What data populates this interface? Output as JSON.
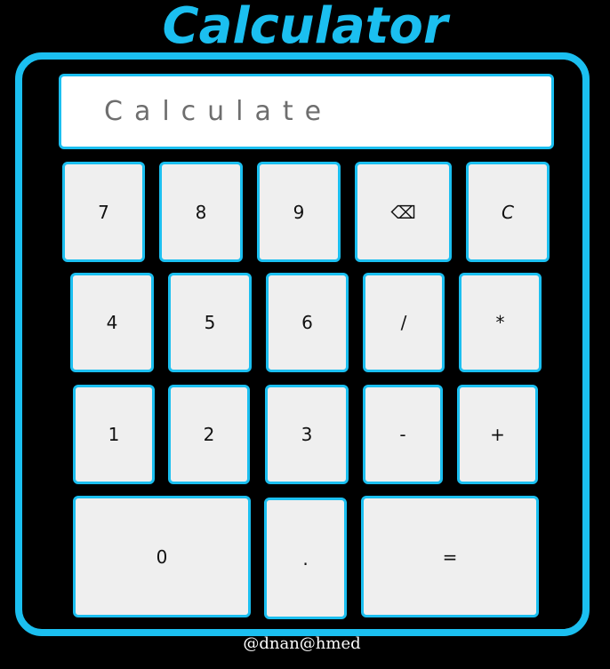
{
  "title": "Calculator",
  "display": {
    "value": "",
    "placeholder": "Calculate"
  },
  "keys": {
    "seven": "7",
    "eight": "8",
    "nine": "9",
    "backspace": "⌫",
    "clear": "C",
    "four": "4",
    "five": "5",
    "six": "6",
    "divide": "/",
    "multiply": "*",
    "one": "1",
    "two": "2",
    "three": "3",
    "minus": "-",
    "plus": "+",
    "zero": "0",
    "decimal": ".",
    "equals": "="
  },
  "footer": "@dnan@hmed",
  "colors": {
    "accent": "#1bbff0",
    "background": "#000000",
    "key_face": "#efefef",
    "display_bg": "#ffffff"
  }
}
